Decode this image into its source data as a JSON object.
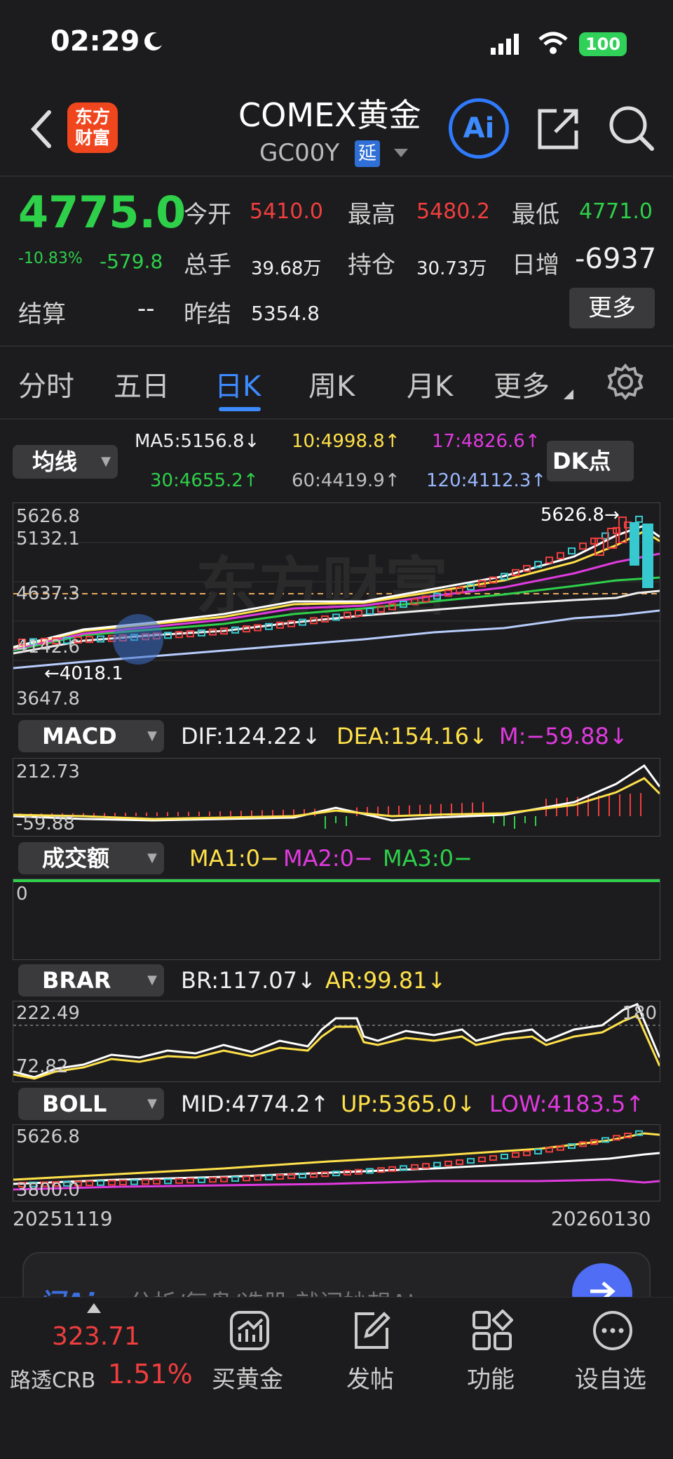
{
  "status": {
    "time": "02:29",
    "battery": "100"
  },
  "header": {
    "logo": "东方\n财富",
    "logo_top": "东方",
    "logo_bottom": "财富",
    "title": "COMEX黄金",
    "code": "GC00Y",
    "delay_badge": "延",
    "ai": "Ai"
  },
  "quote": {
    "price": "4775.0",
    "pct": "-10.83%",
    "chg": "-579.8",
    "open_l": "今开",
    "open_v": "5410.0",
    "high_l": "最高",
    "high_v": "5480.2",
    "low_l": "最低",
    "low_v": "4771.0",
    "vol_l": "总手",
    "vol_v": "39.68万",
    "oi_l": "持仓",
    "oi_v": "30.73万",
    "day_l": "日增",
    "day_v": "-6937",
    "settle_l": "结算",
    "settle_v": "--",
    "prev_l": "昨结",
    "prev_v": "5354.8",
    "more": "更多"
  },
  "tabs": {
    "t1": "分时",
    "t2": "五日",
    "t3": "日K",
    "t4": "周K",
    "t5": "月K",
    "t6": "更多"
  },
  "ma": {
    "select": "均线",
    "ma5": "MA5:5156.8↓",
    "ma10": "10:4998.8↑",
    "ma17": "17:4826.6↑",
    "ma30": "30:4655.2↑",
    "ma60": "60:4419.9↑",
    "ma120": "120:4112.3↑",
    "dk": "DK点"
  },
  "kchart": {
    "y1": "5626.8",
    "y2": "5132.1",
    "y3": "4637.3",
    "y4": "4142.6",
    "y5": "3647.8",
    "hi": "5626.8→",
    "lo": "←4018.1"
  },
  "macd": {
    "select": "MACD",
    "dif": "DIF:124.22↓",
    "dea": "DEA:154.16↓",
    "m": "M:−59.88↓",
    "ytop": "212.73",
    "ybot": "-59.88"
  },
  "vol": {
    "select": "成交额",
    "ma1": "MA1:0−",
    "ma2": "MA2:0−",
    "ma3": "MA3:0−",
    "y": "0"
  },
  "brar": {
    "select": "BRAR",
    "br": "BR:117.07↓",
    "ar": "AR:99.81↓",
    "ytop": "222.49",
    "ybot": "72.82",
    "right": "180"
  },
  "boll": {
    "select": "BOLL",
    "mid": "MID:4774.2↑",
    "up": "UP:5365.0↓",
    "low": "LOW:4183.5↑",
    "ytop": "5626.8",
    "ybot": "3800.0"
  },
  "dates": {
    "start": "20251119",
    "end": "20260130"
  },
  "ai_bar": {
    "brand": "问Ai",
    "text": "分析/复盘/选股 就问妙想AI"
  },
  "bottom": {
    "crb_val": "323.71",
    "crb_name": "路透CRB",
    "crb_pct": "1.51%",
    "buy": "买黄金",
    "post": "发帖",
    "func": "功能",
    "watch": "设自选"
  },
  "colors": {
    "up": "#f03e3e",
    "down": "#2ed04a",
    "accent": "#3d8bff",
    "bg": "#1c1c1e"
  }
}
